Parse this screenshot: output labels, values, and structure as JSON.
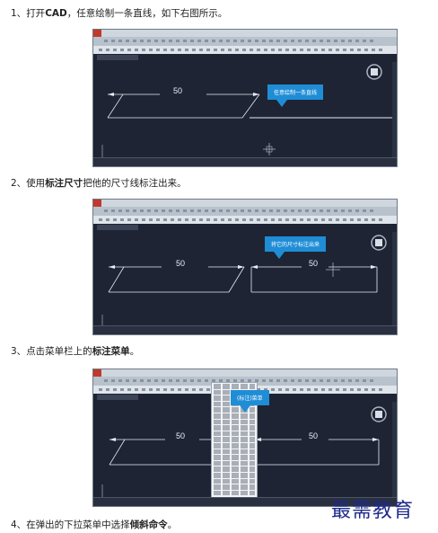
{
  "steps": [
    {
      "number": "1、",
      "pre": "打开",
      "bold": "CAD",
      "post": "，任意绘制一条直线，如下右图所示。"
    },
    {
      "number": "2、",
      "pre": "使用",
      "bold": "标注尺寸",
      "post": "把他的尺寸线标注出来。"
    },
    {
      "number": "3、",
      "pre": "点击菜单栏上的",
      "bold": "标注菜单",
      "post": "。"
    },
    {
      "number": "4、",
      "pre": "在弹出的下拉菜单中选择",
      "bold": "倾斜命令",
      "post": "。"
    }
  ],
  "screenshots": {
    "s1": {
      "dimension": "50",
      "callout": "任意绘制一条直线"
    },
    "s2": {
      "dimension_left": "50",
      "dimension_right": "50",
      "callout": "将它的尺寸标注出来"
    },
    "s3": {
      "dimension_left": "50",
      "dimension_right": "50",
      "callout": "(标注)菜单"
    }
  },
  "watermark": "最需教育",
  "colors": {
    "canvas": "#1e2433",
    "callout": "#1f8dd6",
    "watermark": "#1e2a8c"
  }
}
